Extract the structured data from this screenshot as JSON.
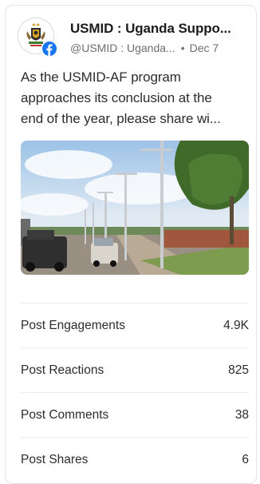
{
  "post": {
    "page_name": "USMID : Uganda Suppo...",
    "handle": "@USMID : Uganda...",
    "separator": "•",
    "date": "Dec 7",
    "text_lines": [
      "As the USMID-AF program",
      "approaches its conclusion at the",
      "end of the year, please share wi..."
    ],
    "avatar_icon": "uganda-coat-of-arms-icon",
    "platform_icon": "facebook-icon",
    "platform_color": "#1877f2"
  },
  "stats": [
    {
      "label": "Post Engagements",
      "value": "4.9K"
    },
    {
      "label": "Post Reactions",
      "value": "825"
    },
    {
      "label": "Post Comments",
      "value": "38"
    },
    {
      "label": "Post Shares",
      "value": "6"
    }
  ]
}
